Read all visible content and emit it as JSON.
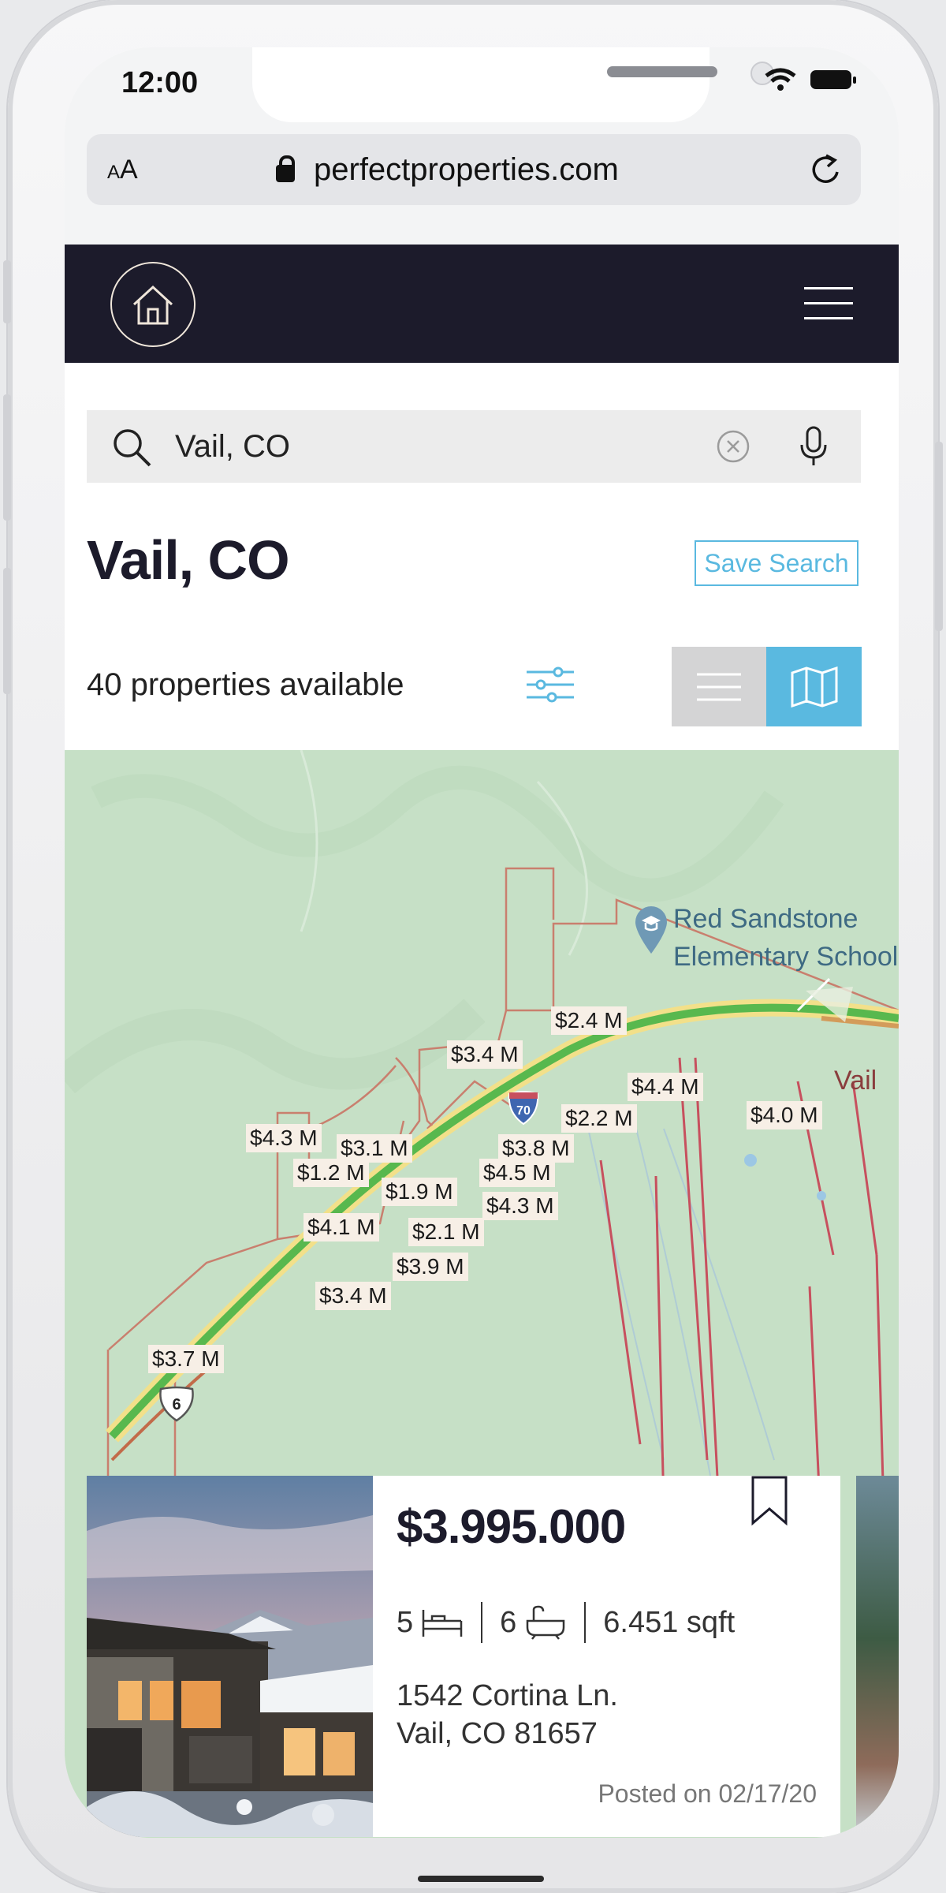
{
  "status_bar": {
    "time": "12:00"
  },
  "browser": {
    "aa_label_small": "A",
    "aa_label_big": "A",
    "url": "perfectproperties.com"
  },
  "search": {
    "value": "Vail, CO"
  },
  "page": {
    "title": "Vail, CO",
    "save_search_label": "Save Search",
    "properties_count": "40 properties available"
  },
  "map": {
    "poi_label_line1": "Red Sandstone",
    "poi_label_line2": "Elementary School",
    "highway_shield": "70",
    "route_shield": "6",
    "town_label": "Vail",
    "price_pins": [
      "$2.4 M",
      "$3.4 M",
      "$4.4 M",
      "$2.2 M",
      "$4.0 M",
      "$4.3 M",
      "$3.1 M",
      "$3.8 M",
      "$1.2 M",
      "$4.5 M",
      "$1.9 M",
      "$4.3 M",
      "$4.1 M",
      "$2.1 M",
      "$3.9 M",
      "$3.4 M",
      "$3.7 M"
    ]
  },
  "listing": {
    "price": "$3.995.000",
    "beds": "5",
    "baths": "6",
    "area": "6.451 sqft",
    "address_line1": "1542 Cortina Ln.",
    "address_line2": "Vail, CO 81657",
    "posted": "Posted on 02/17/20"
  },
  "colors": {
    "navy": "#1c1b2b",
    "accent": "#5ab9e0",
    "map_green": "#c9e2c9"
  }
}
